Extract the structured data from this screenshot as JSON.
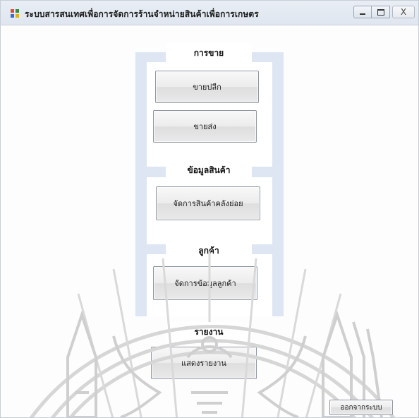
{
  "window": {
    "title": "ระบบสารสนเทศเพื่อการจัดการร้านจำหน่ายสินค้าเพื่อการเกษตร",
    "minimize_icon": "minimize-icon",
    "maximize_icon": "maximize-icon",
    "close_icon": "close-icon",
    "close_glyph": "X"
  },
  "sections": {
    "sales": {
      "label": "การขาย",
      "retail_button": "ขายปลีก",
      "wholesale_button": "ขายส่ง"
    },
    "product": {
      "label": "ข้อมูลสินค้า",
      "manage_button": "จัดการสินค้าคลังย่อย"
    },
    "customer": {
      "label": "ลูกค้า",
      "manage_button": "จัดการข้อมูลลูกค้า"
    },
    "report": {
      "label": "รายงาน",
      "show_button": "แสดงรายงาน"
    }
  },
  "footer": {
    "exit_button": "ออกจากระบบ"
  },
  "colors": {
    "panel": "#dde6f2",
    "titlebar": "#e3e9f1"
  }
}
